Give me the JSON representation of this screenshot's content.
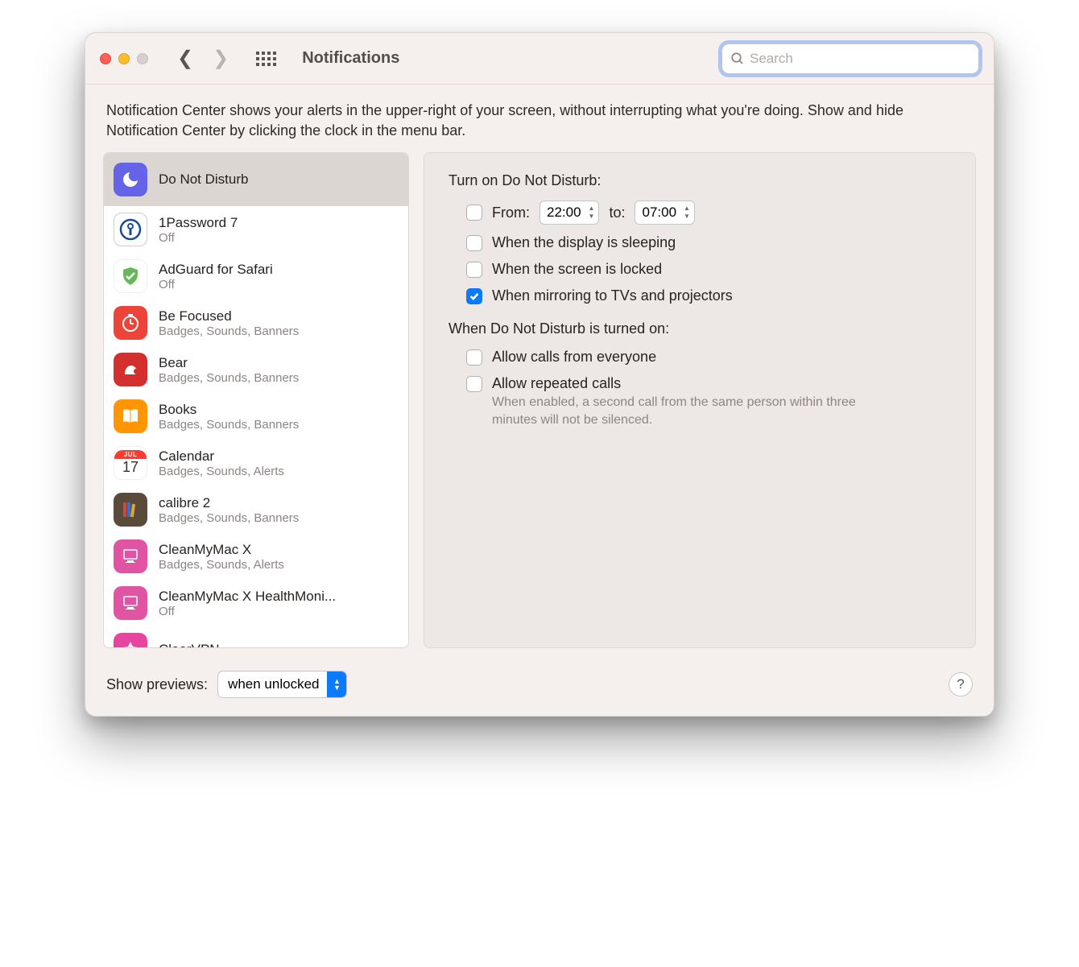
{
  "header": {
    "title": "Notifications",
    "search_placeholder": "Search"
  },
  "intro": "Notification Center shows your alerts in the upper-right of your screen, without interrupting what you're doing. Show and hide Notification Center by clicking the clock in the menu bar.",
  "sidebar": {
    "items": [
      {
        "name": "Do Not Disturb",
        "sub": "",
        "icon": "dnd",
        "selected": true
      },
      {
        "name": "1Password 7",
        "sub": "Off",
        "icon": "onepw"
      },
      {
        "name": "AdGuard for Safari",
        "sub": "Off",
        "icon": "adguard"
      },
      {
        "name": "Be Focused",
        "sub": "Badges, Sounds, Banners",
        "icon": "befocused"
      },
      {
        "name": "Bear",
        "sub": "Badges, Sounds, Banners",
        "icon": "bear"
      },
      {
        "name": "Books",
        "sub": "Badges, Sounds, Banners",
        "icon": "books"
      },
      {
        "name": "Calendar",
        "sub": "Badges, Sounds, Alerts",
        "icon": "calendar"
      },
      {
        "name": "calibre 2",
        "sub": "Badges, Sounds, Banners",
        "icon": "calibre"
      },
      {
        "name": "CleanMyMac X",
        "sub": "Badges, Sounds, Alerts",
        "icon": "cmm"
      },
      {
        "name": "CleanMyMac X HealthMoni...",
        "sub": "Off",
        "icon": "cmm"
      },
      {
        "name": "ClearVPN",
        "sub": "",
        "icon": "clearvpn"
      }
    ]
  },
  "panel": {
    "turn_on_title": "Turn on Do Not Disturb:",
    "from_label": "From:",
    "to_label": "to:",
    "from_time": "22:00",
    "to_time": "07:00",
    "from_checked": false,
    "opt_sleeping": "When the display is sleeping",
    "opt_sleeping_checked": false,
    "opt_locked": "When the screen is locked",
    "opt_locked_checked": false,
    "opt_mirroring": "When mirroring to TVs and projectors",
    "opt_mirroring_checked": true,
    "when_on_title": "When Do Not Disturb is turned on:",
    "allow_everyone": "Allow calls from everyone",
    "allow_everyone_checked": false,
    "allow_repeated": "Allow repeated calls",
    "allow_repeated_checked": false,
    "repeated_hint": "When enabled, a second call from the same person within three minutes will not be silenced."
  },
  "footer": {
    "label": "Show previews:",
    "select_value": "when unlocked"
  },
  "calendar_icon": {
    "month": "JUL",
    "day": "17"
  }
}
